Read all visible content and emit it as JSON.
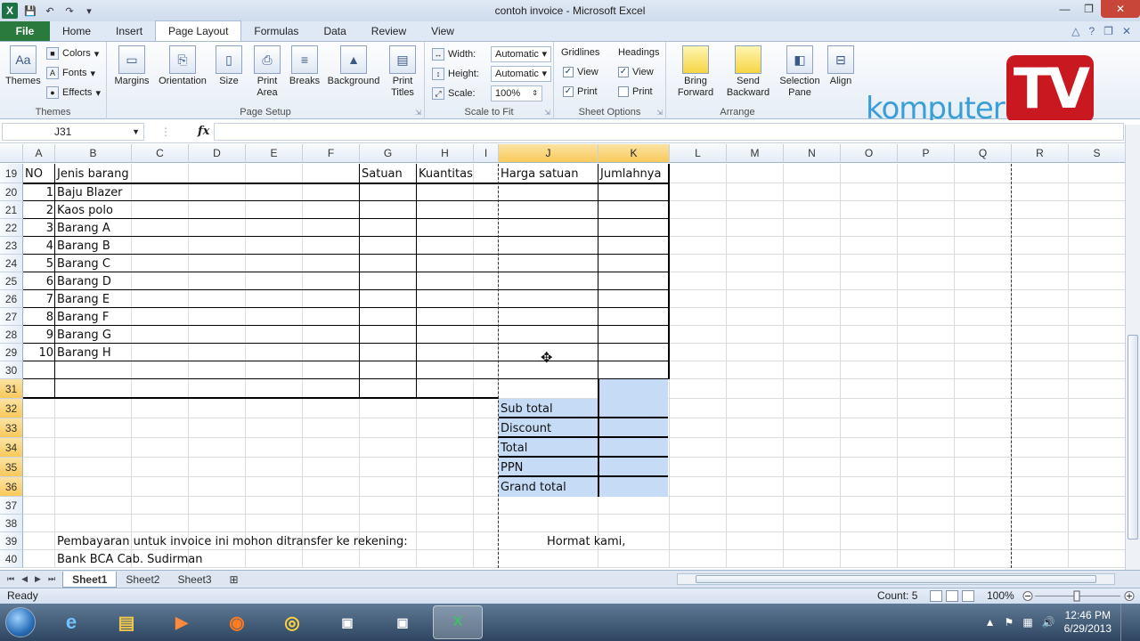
{
  "window": {
    "title": "contoh invoice  -  Microsoft Excel"
  },
  "tabs": [
    "File",
    "Home",
    "Insert",
    "Page Layout",
    "Formulas",
    "Data",
    "Review",
    "View"
  ],
  "ribbon": {
    "themes": {
      "big": "Themes",
      "colors": "Colors",
      "fonts": "Fonts",
      "effects": "Effects",
      "label": "Themes"
    },
    "page_setup": {
      "buttons": [
        "Margins",
        "Orientation",
        "Size",
        "Print\nArea",
        "Breaks",
        "Background",
        "Print\nTitles"
      ],
      "label": "Page Setup"
    },
    "scale": {
      "width_label": "Width:",
      "width_value": "Automatic",
      "height_label": "Height:",
      "height_value": "Automatic",
      "scale_label": "Scale:",
      "scale_value": "100%",
      "label": "Scale to Fit"
    },
    "sheet_options": {
      "gridlines": "Gridlines",
      "headings": "Headings",
      "view": "View",
      "print": "Print",
      "label": "Sheet Options"
    },
    "arrange": {
      "buttons": [
        "Bring\nForward",
        "Send\nBackward",
        "Selection\nPane",
        "Align"
      ],
      "label": "Arrange"
    }
  },
  "brand": {
    "name": "komputer",
    "badge": "TV"
  },
  "formula_bar": {
    "name_box": "J31",
    "fx": "fx",
    "value": ""
  },
  "columns": [
    "A",
    "B",
    "C",
    "D",
    "E",
    "F",
    "G",
    "H",
    "I",
    "J",
    "K",
    "L",
    "M",
    "N",
    "O",
    "P",
    "Q",
    "R",
    "S"
  ],
  "rows": [
    "19",
    "20",
    "21",
    "22",
    "23",
    "24",
    "25",
    "26",
    "27",
    "28",
    "29",
    "30",
    "31",
    "32",
    "33",
    "34",
    "35",
    "36",
    "37",
    "38",
    "39",
    "40"
  ],
  "table": {
    "headers": {
      "no": "NO",
      "item": "Jenis barang",
      "unit": "Satuan",
      "qty": "Kuantitas",
      "price": "Harga satuan",
      "total": "Jumlahnya"
    },
    "items": [
      {
        "no": "1",
        "name": "Baju Blazer"
      },
      {
        "no": "2",
        "name": "Kaos polo"
      },
      {
        "no": "3",
        "name": "Barang A"
      },
      {
        "no": "4",
        "name": "Barang B"
      },
      {
        "no": "5",
        "name": "Barang C"
      },
      {
        "no": "6",
        "name": "Barang D"
      },
      {
        "no": "7",
        "name": "Barang E"
      },
      {
        "no": "8",
        "name": "Barang F"
      },
      {
        "no": "9",
        "name": "Barang G"
      },
      {
        "no": "10",
        "name": "Barang H"
      }
    ]
  },
  "summary": [
    "Sub total",
    "Discount",
    "Total",
    "PPN",
    "Grand total"
  ],
  "footer": {
    "payment": "Pembayaran untuk invoice ini mohon ditransfer ke rekening:",
    "bank": "Bank BCA Cab. Sudirman",
    "regards": "Hormat kami,"
  },
  "sheets": [
    "Sheet1",
    "Sheet2",
    "Sheet3"
  ],
  "status": {
    "ready": "Ready",
    "count": "Count: 5",
    "zoom": "100%"
  },
  "taskbar": {
    "time": "12:46 PM",
    "date": "6/29/2013"
  }
}
